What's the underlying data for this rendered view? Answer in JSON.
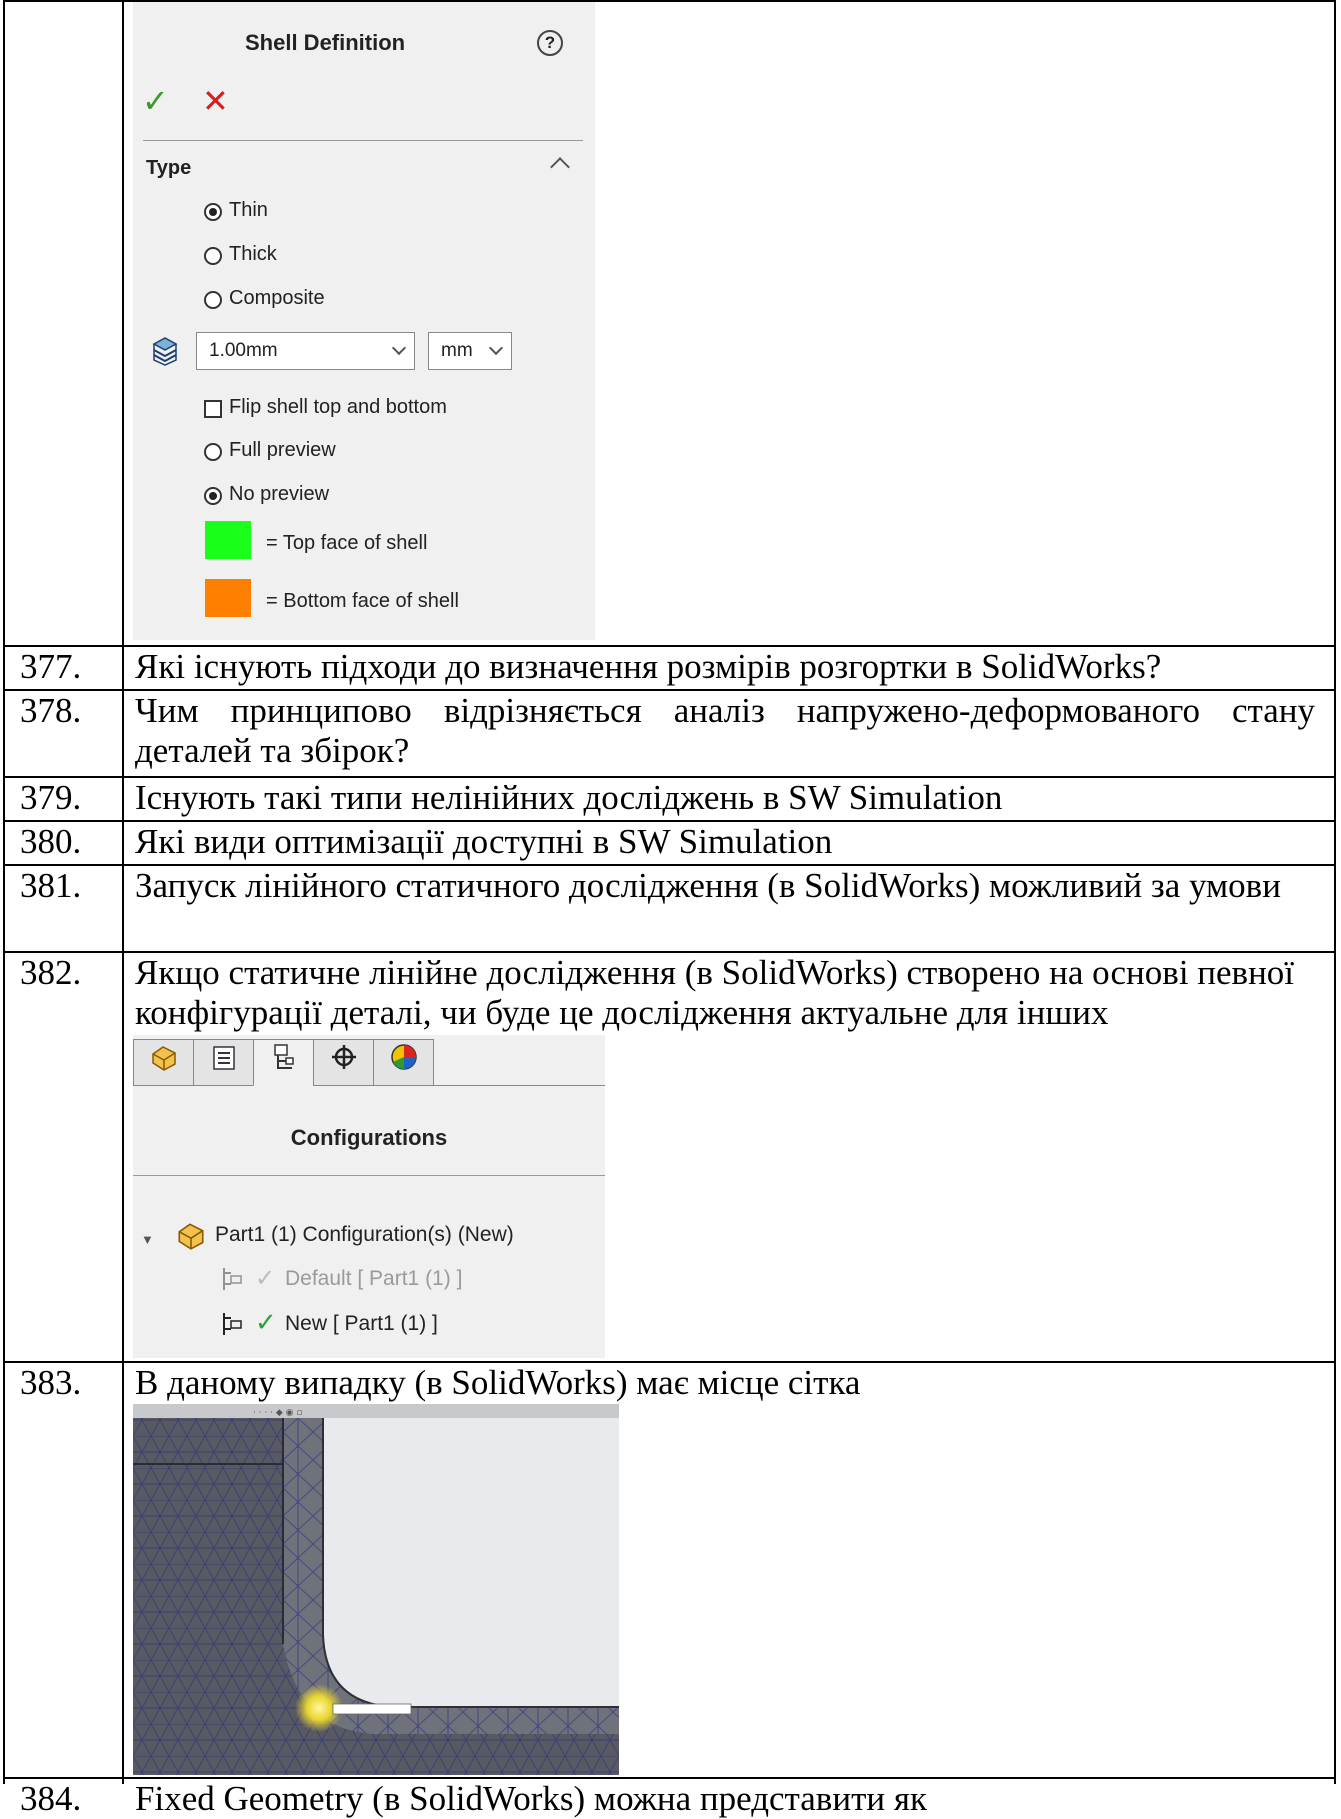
{
  "shell_panel": {
    "title": "Shell Definition",
    "help_icon": "?",
    "ok_icon": "✓",
    "cancel_icon": "✕",
    "section_title": "Type",
    "type_options": [
      {
        "label": "Thin",
        "selected": true
      },
      {
        "label": "Thick",
        "selected": false
      },
      {
        "label": "Composite",
        "selected": false
      }
    ],
    "thickness_value": "1.00mm",
    "unit_value": "mm",
    "flip_label": "Flip shell top and bottom",
    "preview_options": [
      {
        "label": "Full preview",
        "selected": false
      },
      {
        "label": "No preview",
        "selected": true
      }
    ],
    "legend": [
      {
        "label": "= Top face of shell",
        "color": "#19ff19"
      },
      {
        "label": "= Bottom face of shell",
        "color": "#ff7f00"
      }
    ]
  },
  "questions": [
    {
      "number": "377.",
      "text": "Які існують підходи до визначення розмірів розгортки в SolidWorks?"
    },
    {
      "number": "378.",
      "text": "Чим принципово відрізняється аналіз напружено-деформованого стану деталей та збірок?"
    },
    {
      "number": "379.",
      "text": "Існують такі типи нелінійних досліджень в SW Simulation"
    },
    {
      "number": "380.",
      "text": "Які види оптимізації доступні в SW Simulation"
    },
    {
      "number": "381.",
      "text": "Запуск лінійного статичного дослідження  (в SolidWorks) можливий за умови"
    },
    {
      "number": "382.",
      "text": "Якщо статичне лінійне дослідження (в SolidWorks) створено на основі певної конфігурації деталі, чи буде це дослідження актуальне для інших конфігурацій деталей?"
    },
    {
      "number": "383.",
      "text": "В даному випадку (в SolidWorks) має місце сітка"
    },
    {
      "number": "384.",
      "text": "Fixed Geometry (в SolidWorks) можна представити як"
    }
  ],
  "config_panel": {
    "tabs": [
      "part-icon",
      "property-manager-icon",
      "configuration-manager-icon",
      "dimxpert-icon",
      "display-manager-icon"
    ],
    "title": "Configurations",
    "root": "Part1 (1) Configuration(s)  (New)",
    "items": [
      {
        "label": "Default [ Part1 (1) ]",
        "active": false
      },
      {
        "label": "New [ Part1 (1) ]",
        "active": true
      }
    ]
  },
  "mesh_image": {
    "label": "SolidWorks mesh fillet view"
  }
}
